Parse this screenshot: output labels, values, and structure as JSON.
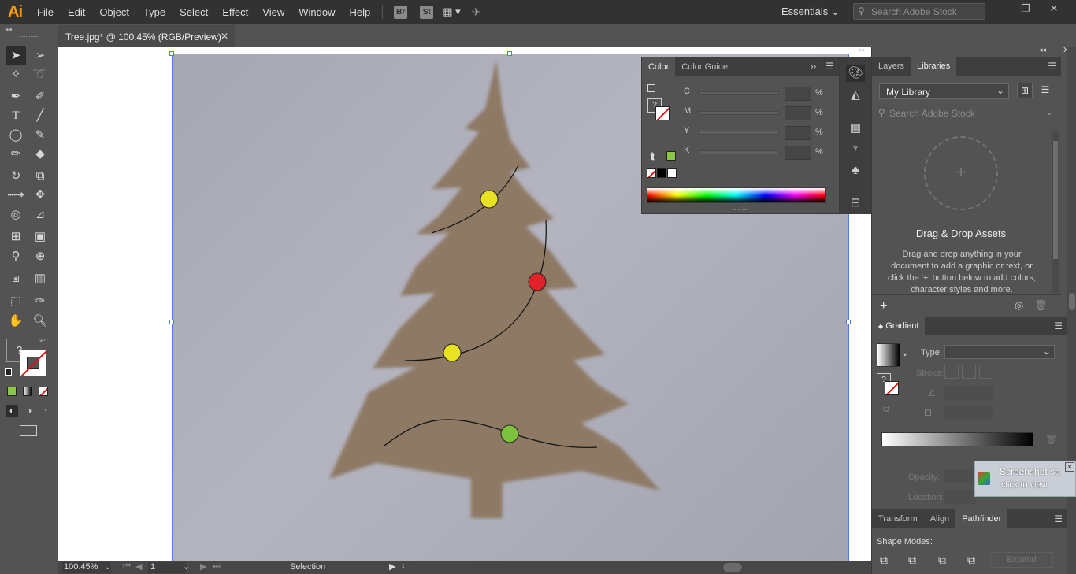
{
  "app": {
    "logo": "Ai"
  },
  "menu": [
    "File",
    "Edit",
    "Object",
    "Type",
    "Select",
    "Effect",
    "View",
    "Window",
    "Help"
  ],
  "menu_buttons": {
    "bridge": "Br",
    "stock": "St"
  },
  "workspace": {
    "label": "Essentials"
  },
  "stock_search": {
    "placeholder": "Search Adobe Stock"
  },
  "document": {
    "tab_title": "Tree.jpg* @ 100.45% (RGB/Preview)"
  },
  "status": {
    "zoom": "100.45%",
    "artboard": "1",
    "tool": "Selection"
  },
  "color_panel": {
    "tabs": [
      "Color",
      "Color Guide"
    ],
    "channels": [
      "C",
      "M",
      "Y",
      "K"
    ],
    "percent": "%",
    "swatch_color": "#8dc63f"
  },
  "right_panel": {
    "tabs": [
      "Layers",
      "Libraries"
    ],
    "library_name": "My Library",
    "search_placeholder": "Search Adobe Stock",
    "drop_title": "Drag & Drop Assets",
    "drop_body": "Drag and drop anything in your document to add a graphic or text, or click the '+' button below to add colors, character styles and more."
  },
  "gradient_panel": {
    "title": "Gradient",
    "type_label": "Type:",
    "stroke_label": "Stroke:",
    "opacity_label": "Opacity:",
    "location_label": "Location:"
  },
  "bottom_panel": {
    "tabs": [
      "Transform",
      "Align",
      "Pathfinder"
    ],
    "shape_modes_label": "Shape Modes:",
    "expand_label": "Expand"
  },
  "toast": {
    "title": "Screenshot sa",
    "subtitle": "click to view"
  },
  "ornaments": {
    "colors": [
      "#e8e222",
      "#e0222a",
      "#e8e222",
      "#7dc13f"
    ]
  }
}
